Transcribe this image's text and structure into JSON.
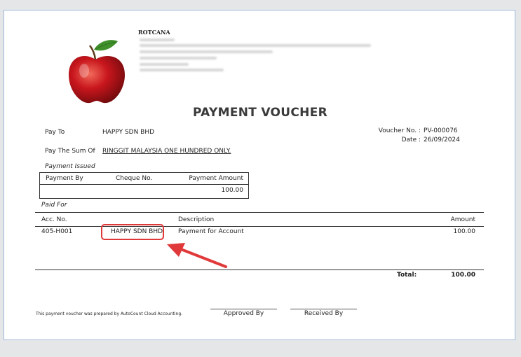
{
  "company": {
    "name": "ROTCANA",
    "logo_icon": "apple-icon"
  },
  "voucher": {
    "title": "PAYMENT VOUCHER",
    "pay_to_label": "Pay To",
    "pay_to_value": "HAPPY SDN BHD",
    "sum_label": "Pay The Sum Of",
    "sum_value": "RINGGIT MALAYSIA ONE HUNDRED ONLY.",
    "voucher_no_label": "Voucher No. :",
    "voucher_no_value": "PV-000076",
    "date_label": "Date :",
    "date_value": "26/09/2024"
  },
  "payment_issued": {
    "section_label": "Payment Issued",
    "headers": [
      "Payment By",
      "Cheque No.",
      "Payment Amount"
    ],
    "row": {
      "payment_by": "",
      "cheque_no": "",
      "amount": "100.00"
    }
  },
  "paid_for": {
    "section_label": "Paid For",
    "headers": {
      "acc_no": "Acc. No.",
      "description": "Description",
      "amount": "Amount"
    },
    "rows": [
      {
        "acc_no": "405-H001",
        "name": "HAPPY SDN BHD",
        "description": "Payment for Account",
        "amount": "100.00"
      }
    ],
    "total_label": "Total:",
    "total_value": "100.00"
  },
  "footer": {
    "prepared_text": "This payment voucher was prepared by AutoCount Cloud Accounting.",
    "approved_by": "Approved By",
    "received_by": "Received By"
  },
  "annotation": {
    "highlight_color": "#e0393a"
  }
}
